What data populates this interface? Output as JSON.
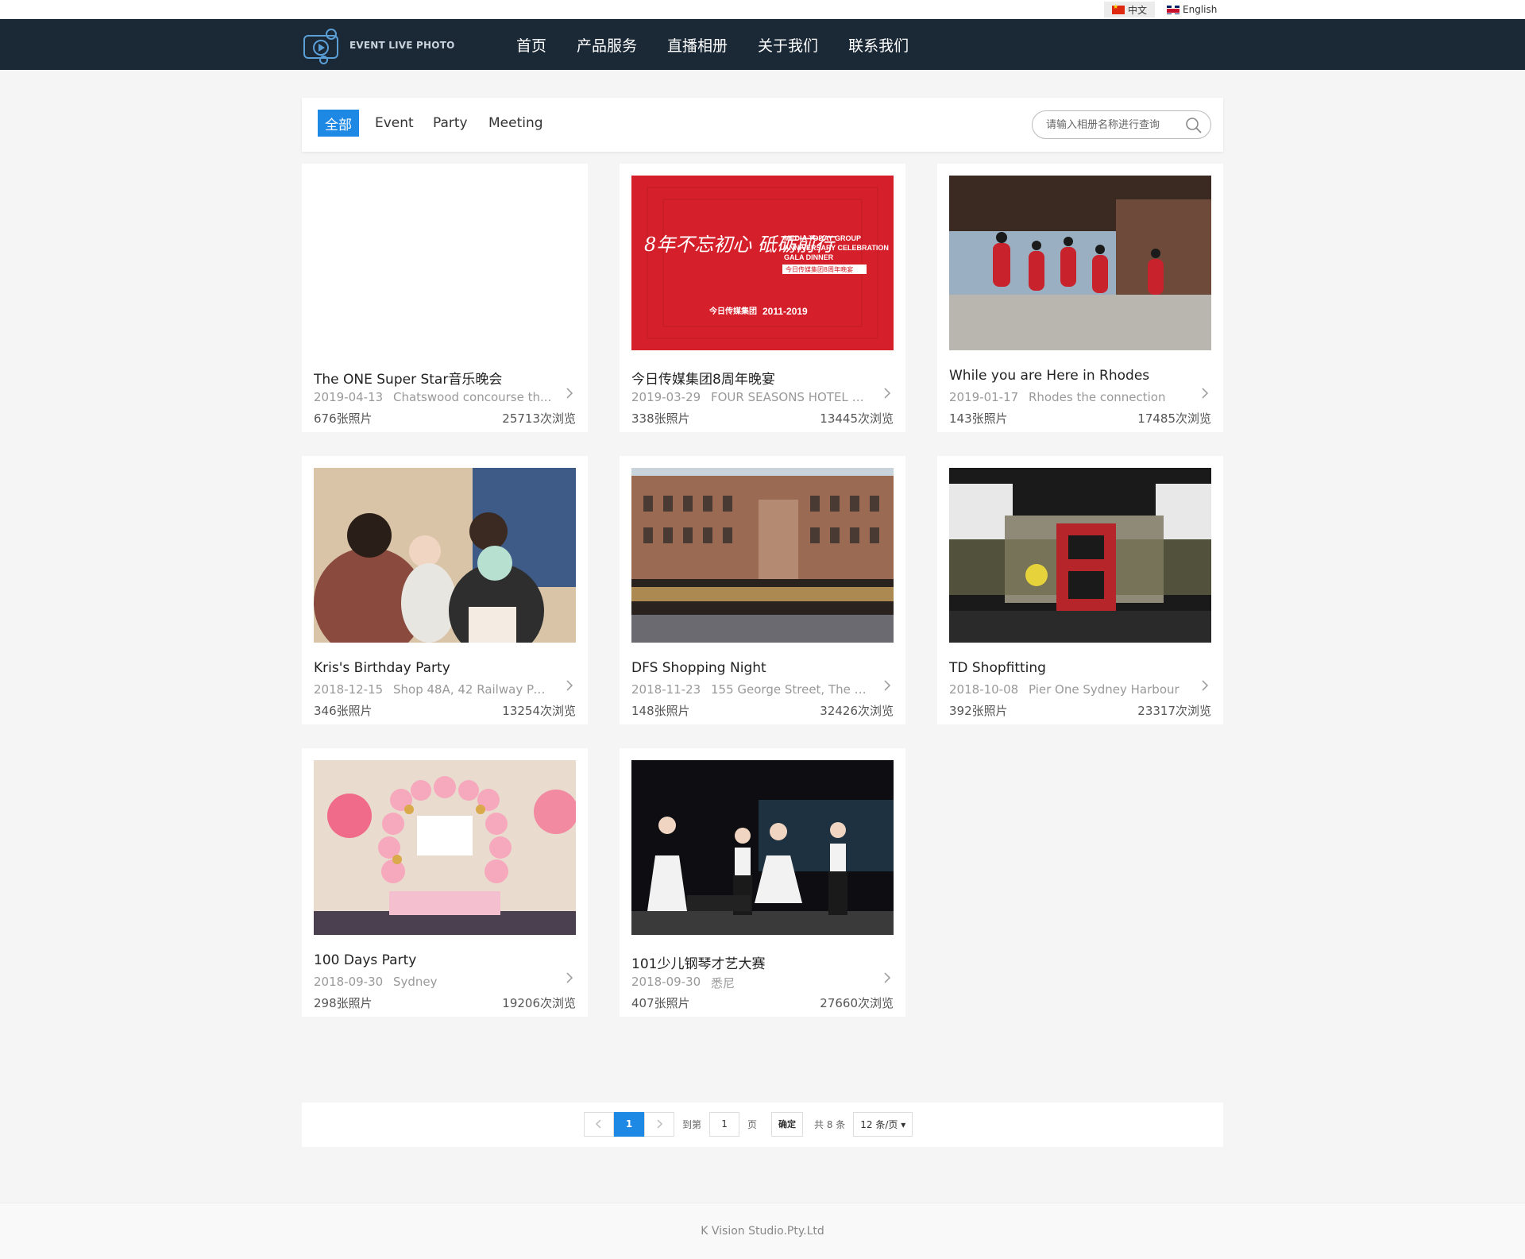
{
  "lang": {
    "cn": "中文",
    "en": "English"
  },
  "brand": {
    "logo_text": "EVENT LIVE PHOTO"
  },
  "nav": [
    "首页",
    "产品服务",
    "直播相册",
    "关于我们",
    "联系我们"
  ],
  "filters": {
    "tabs": [
      "全部",
      "Event",
      "Party",
      "Meeting"
    ],
    "active": "全部",
    "search_placeholder": "请输入相册名称进行查询"
  },
  "albums": [
    {
      "title": "The ONE Super Star音乐晚会",
      "date": "2019-04-13",
      "location": "Chatswood concourse th...",
      "photos": "676张照片",
      "views": "25713次浏览"
    },
    {
      "title": "今日传媒集团8周年晚宴",
      "date": "2019-03-29",
      "location": "FOUR SEASONS HOTEL S...",
      "photos": "338张照片",
      "views": "13445次浏览",
      "poster": {
        "headline_cn": "8年不忘初心 砥砺前行",
        "headline_en_1": "MEDIA TODAY GROUP",
        "headline_en_2": "ANNIVERSARY CELEBRATION",
        "headline_en_3": "GALA DINNER",
        "sub_cn": "今日传媒集团8周年晚宴",
        "company": "今日传媒集团",
        "years": "2011-2019"
      }
    },
    {
      "title": "While you are Here in Rhodes",
      "date": "2019-01-17",
      "location": "Rhodes the connection",
      "photos": "143张照片",
      "views": "17485次浏览"
    },
    {
      "title": "Kris's Birthday Party",
      "date": "2018-12-15",
      "location": "Shop 48A, 42 Railway Par...",
      "photos": "346张照片",
      "views": "13254次浏览"
    },
    {
      "title": "DFS Shopping Night",
      "date": "2018-11-23",
      "location": "155 George Street, The R...",
      "photos": "148张照片",
      "views": "32426次浏览"
    },
    {
      "title": "TD Shopfitting",
      "date": "2018-10-08",
      "location": "Pier One Sydney Harbour",
      "photos": "392张照片",
      "views": "23317次浏览"
    },
    {
      "title": "100 Days Party",
      "date": "2018-09-30",
      "location": "Sydney",
      "photos": "298张照片",
      "views": "19206次浏览"
    },
    {
      "title": "101少儿钢琴才艺大赛",
      "date": "2018-09-30",
      "location": "悉尼",
      "photos": "407张照片",
      "views": "27660次浏览"
    }
  ],
  "pagination": {
    "current_page": "1",
    "goto_label": "到第",
    "goto_value": "1",
    "page_unit": "页",
    "confirm": "确定",
    "total": "共 8 条",
    "page_size": "12 条/页 ▾"
  },
  "footer": {
    "text": "K Vision Studio.Pty.Ltd"
  },
  "colors": {
    "header_bg": "#1b2836",
    "accent": "#1e88e5",
    "page_bg": "#f5f5f5"
  },
  "icons": {
    "search": "search-icon",
    "arrow": "chevron-right-icon",
    "prev": "chevron-left-icon",
    "next": "chevron-right-icon"
  }
}
